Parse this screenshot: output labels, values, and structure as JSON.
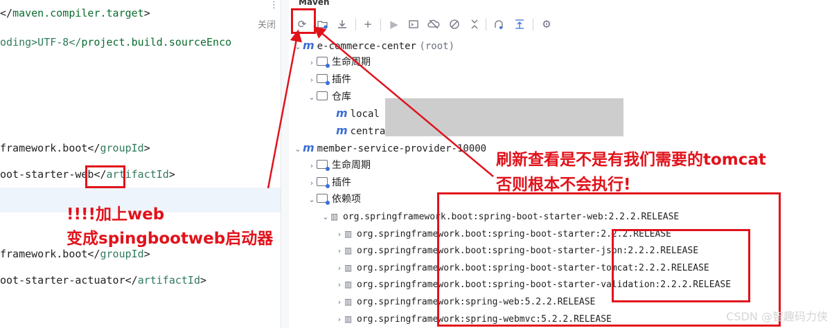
{
  "editor": {
    "lines": [
      {
        "before": "</",
        "name": "maven.compiler.target",
        "after": ">"
      },
      {
        "before": "oding>UTF-8</",
        "name": "project.build.sourceEnco",
        "after": ""
      },
      {
        "before": "framework.boot</",
        "name": "groupId",
        "after": ">"
      },
      {
        "before": "oot-starter",
        "mid": "-web",
        "after2": "</",
        "name": "artifactId",
        "after": ">"
      },
      {
        "before": "framework.boot</",
        "name": "groupId",
        "after": ">"
      },
      {
        "before": "oot-starter-actuator</",
        "name": "artifactId",
        "after": ">"
      }
    ],
    "close_label": "关闭",
    "more_label": "⋮"
  },
  "annotations": {
    "left_line1": "!!!!加上web",
    "left_line2": "变成spingbootweb启动器",
    "right_line1": "刷新查看是不是有我们需要的tomcat",
    "right_line2": "否则根本不会执行!"
  },
  "maven": {
    "title": "Maven",
    "toolbar": [
      {
        "icon": "refresh-icon"
      },
      {
        "icon": "folder-plus-icon"
      },
      {
        "icon": "download-icon"
      },
      {
        "icon": "plus-icon"
      },
      {
        "icon": "run-icon"
      },
      {
        "icon": "config-icon"
      },
      {
        "icon": "offline-icon"
      },
      {
        "icon": "skip-tests-icon"
      },
      {
        "icon": "collapse-icon"
      },
      {
        "icon": "show-deps-icon"
      },
      {
        "icon": "collapse-all-icon"
      },
      {
        "icon": "settings-icon"
      }
    ],
    "tree": [
      {
        "label": "e-commerce-center",
        "suffix": "(root)"
      },
      {
        "label": "生命周期"
      },
      {
        "label": "插件"
      },
      {
        "label": "仓库"
      },
      {
        "label": "local"
      },
      {
        "label": "centra"
      },
      {
        "label": "member-service-provider-10000"
      },
      {
        "label": "生命周期"
      },
      {
        "label": "插件"
      },
      {
        "label": "依赖项"
      },
      {
        "label": "org.springframework.boot:spring-boot-starter-web:2.2.2.RELEASE"
      },
      {
        "label": "org.springframework.boot:spring-boot-starter:2.2.2.RELEASE"
      },
      {
        "label": "org.springframework.boot:spring-boot-starter-json:2.2.2.RELEASE"
      },
      {
        "label": "org.springframework.boot:spring-boot-starter-tomcat:2.2.2.RELEASE"
      },
      {
        "label": "org.springframework.boot:spring-boot-starter-validation:2.2.2.RELEASE"
      },
      {
        "label": "org.springframework:spring-web:5.2.2.RELEASE"
      },
      {
        "label": "org.springframework:spring-webmvc:5.2.2.RELEASE"
      }
    ]
  },
  "watermark": "CSDN @智趣码力侠",
  "colors": {
    "annotation_red": "#e1121b",
    "maven_blue": "#3b6fd6",
    "xml_tag": "#0b6b2e"
  }
}
